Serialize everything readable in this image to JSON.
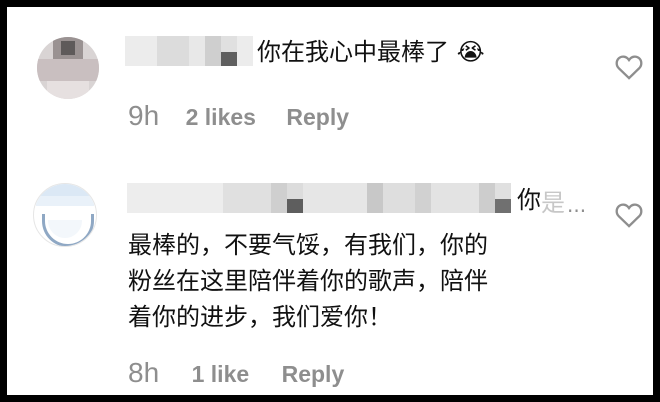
{
  "comments": [
    {
      "text": "你在我心中最棒了 😭",
      "time": "9h",
      "likes": "2 likes",
      "reply": "Reply"
    },
    {
      "text_first": "你",
      "faded": "是",
      "ellipsis": "...",
      "line2": "最棒的，不要气馁，有我们，你的",
      "line3": "粉丝在这里陪伴着你的歌声，陪伴",
      "line4": "着你的进步，我们爱你！",
      "time": "8h",
      "likes": "1 like",
      "reply": "Reply"
    }
  ],
  "colors": {
    "meta": "#8e8e8e",
    "heart_outline": "#8e8e8e",
    "frame": "#000000"
  }
}
